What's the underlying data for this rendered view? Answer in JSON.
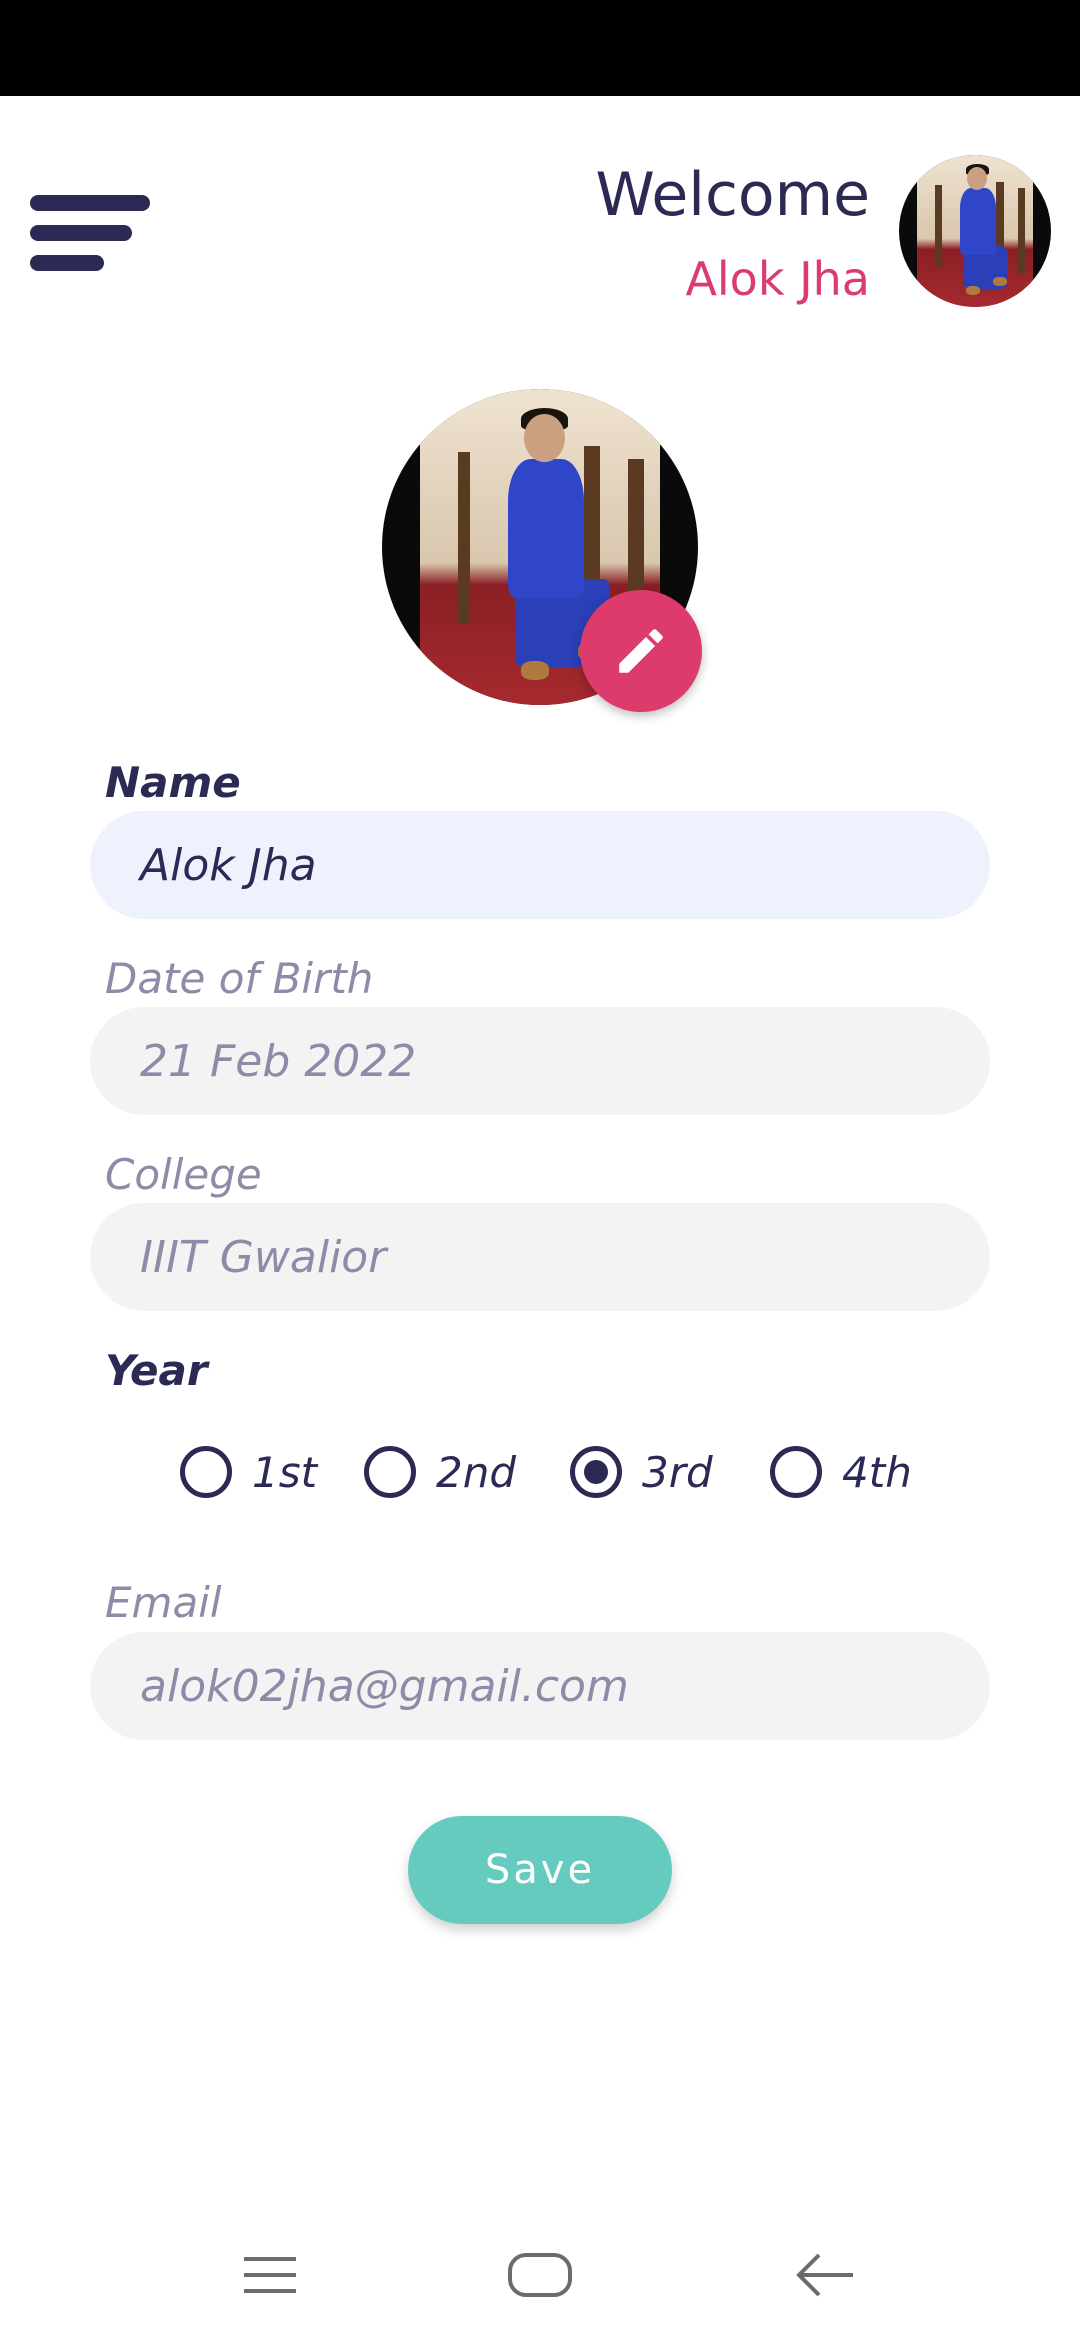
{
  "header": {
    "welcome_text": "Welcome",
    "username": "Alok Jha"
  },
  "profile": {
    "photo_alt": "Alok Jha"
  },
  "form": {
    "name": {
      "label": "Name",
      "value": "Alok Jha"
    },
    "dob": {
      "label": "Date of Birth",
      "value": "21 Feb 2022"
    },
    "college": {
      "label": "College",
      "value": "IIIT Gwalior"
    },
    "year": {
      "label": "Year",
      "options": [
        "1st",
        "2nd",
        "3rd",
        "4th"
      ],
      "selected": "3rd"
    },
    "email": {
      "label": "Email",
      "value": "alok02jha@gmail.com"
    }
  },
  "actions": {
    "save_label": "Save"
  },
  "colors": {
    "primary": "#2b2a55",
    "accent": "#dc3b72",
    "save": "#66cbbf",
    "active_field": "#eef2fc",
    "muted_field": "#f3f3f3",
    "muted_text": "#8e8ba8"
  },
  "icons": {
    "menu": "menu-icon",
    "edit": "pencil-icon",
    "nav_recents": "recents-icon",
    "nav_home": "home-icon",
    "nav_back": "back-icon"
  }
}
